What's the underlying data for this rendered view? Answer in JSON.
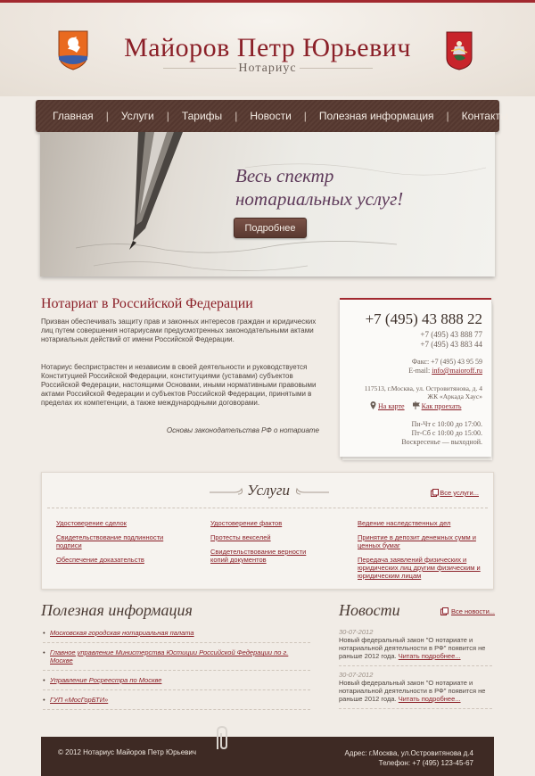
{
  "header": {
    "title": "Майоров Петр Юрьевич",
    "subtitle": "Нотариус",
    "logo_left": "district-coat-of-arms-icon",
    "logo_right": "moscow-coat-of-arms-icon"
  },
  "nav": {
    "items": [
      "Главная",
      "Услуги",
      "Тарифы",
      "Новости",
      "Полезная информация",
      "Контакты"
    ],
    "separator": "|"
  },
  "hero": {
    "line1": "Весь спектр",
    "line2": "нотариальных услуг!",
    "button": "Подробнее",
    "image": "fountain-pen-writing"
  },
  "intro": {
    "title": "Нотариат в Российской Федерации",
    "p1": "Призван обеспечивать защиту прав и законных интересов граждан и юридических лиц путем совершения нотариусами предусмотренных законодательными актами нотариальных действий от имени Российской Федерации.",
    "p2": "Нотариус беспристрастен и независим в своей деятельности и руководствуется Конституцией Российской Федерации, конституциями (уставами) субъектов Российской Федерации, настоящими Основами, иными нормативными правовыми актами Российской Федерации и субъектов Российской Федерации, принятыми в пределах их компетенции, а также международными договорами.",
    "quote": "Основы законодательства РФ о нотариате"
  },
  "contact": {
    "phone_main": "+7 (495) 43 888 22",
    "phone2": "+7 (495) 43 888 77",
    "phone3": "+7 (495) 43 883 44",
    "fax": "Факс: +7 (495) 43 95 59",
    "email_label": "E-mail:",
    "email": "info@maioroff.ru",
    "address1": "117513, г.Москва, ул. Островитянова, д. 4",
    "address2": "ЖК «Аркада Хаус»",
    "map_link": "На карте",
    "route_link": "Как проехать",
    "hours1": "Пн-Чт с 10:00 до 17:00.",
    "hours2": "Пт-Сб с 10:00 до 15:00.",
    "hours3": "Воскресенье — выходной."
  },
  "services": {
    "title": "Услуги",
    "all_link": "Все услуги...",
    "col1": [
      "Удостоверение сделок",
      "Свидетельствование подлинности подписи",
      "Обеспечение доказательств"
    ],
    "col2": [
      "Удостоверение фактов",
      "Протесты векселей",
      "Свидетельствование верности копий документов"
    ],
    "col3": [
      "Ведение наследственных дел",
      "Принятие в депозит денежных сумм и ценных бумаг",
      "Передача заявлений физических и юридических лиц другим физическим и юридическим лицам"
    ]
  },
  "useful": {
    "title": "Полезная информация",
    "items": [
      "Московская городская нотариальная палата",
      "Главное управление Министерства Юстиции Российской Федерации по г. Москве",
      "Управление Росреестра по Москве",
      "ГУП «МосГорБТИ»"
    ]
  },
  "news": {
    "title": "Новости",
    "all_link": "Все новости...",
    "items": [
      {
        "date": "30-07-2012",
        "text": "Новый федеральный закон \"О нотариате и нотариальной деятельности в РФ\" появится не раньше 2012 года.",
        "more": "Читать подробнее..."
      },
      {
        "date": "30-07-2012",
        "text": "Новый федеральный закон \"О нотариате и нотариальной деятельности в РФ\" появится не раньше 2012 года.",
        "more": "Читать подробнее..."
      }
    ]
  },
  "footer": {
    "copyright": "© 2012 Нотариус Майоров Петр Юрьевич",
    "address": "Адрес: г.Москва, ул.Островитянова д.4",
    "phone": "Телефон: +7 (495) 123-45-67"
  },
  "colors": {
    "accent": "#8b2028",
    "nav_bg": "#5c3f36",
    "page_bg": "#f1ece6",
    "footer_bg": "#3e2a24"
  }
}
